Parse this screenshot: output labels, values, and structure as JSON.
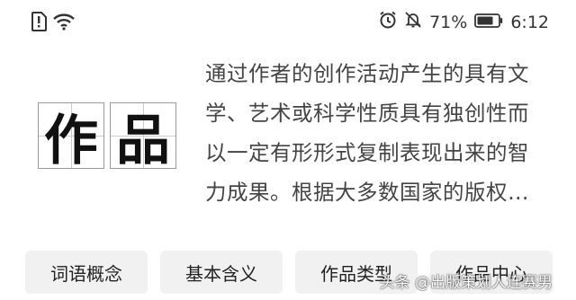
{
  "status_bar": {
    "battery_percent": "71%",
    "time": "6:12",
    "icons": [
      "alert-icon",
      "wifi-icon",
      "alarm-icon",
      "mute-icon",
      "battery-icon"
    ]
  },
  "hero": {
    "characters": [
      "作",
      "品"
    ],
    "description": "通过作者的创作活动产生的具有文学、艺术或科学性质具有独创性而以一定有形形式复制表现出来的智力成果。根据大多数国家的版权法…"
  },
  "tabs": [
    {
      "label": "词语概念"
    },
    {
      "label": "基本含义"
    },
    {
      "label": "作品类型"
    },
    {
      "label": "作品中心"
    }
  ],
  "watermark": {
    "text": "头条 @出版策划人连赛男"
  }
}
